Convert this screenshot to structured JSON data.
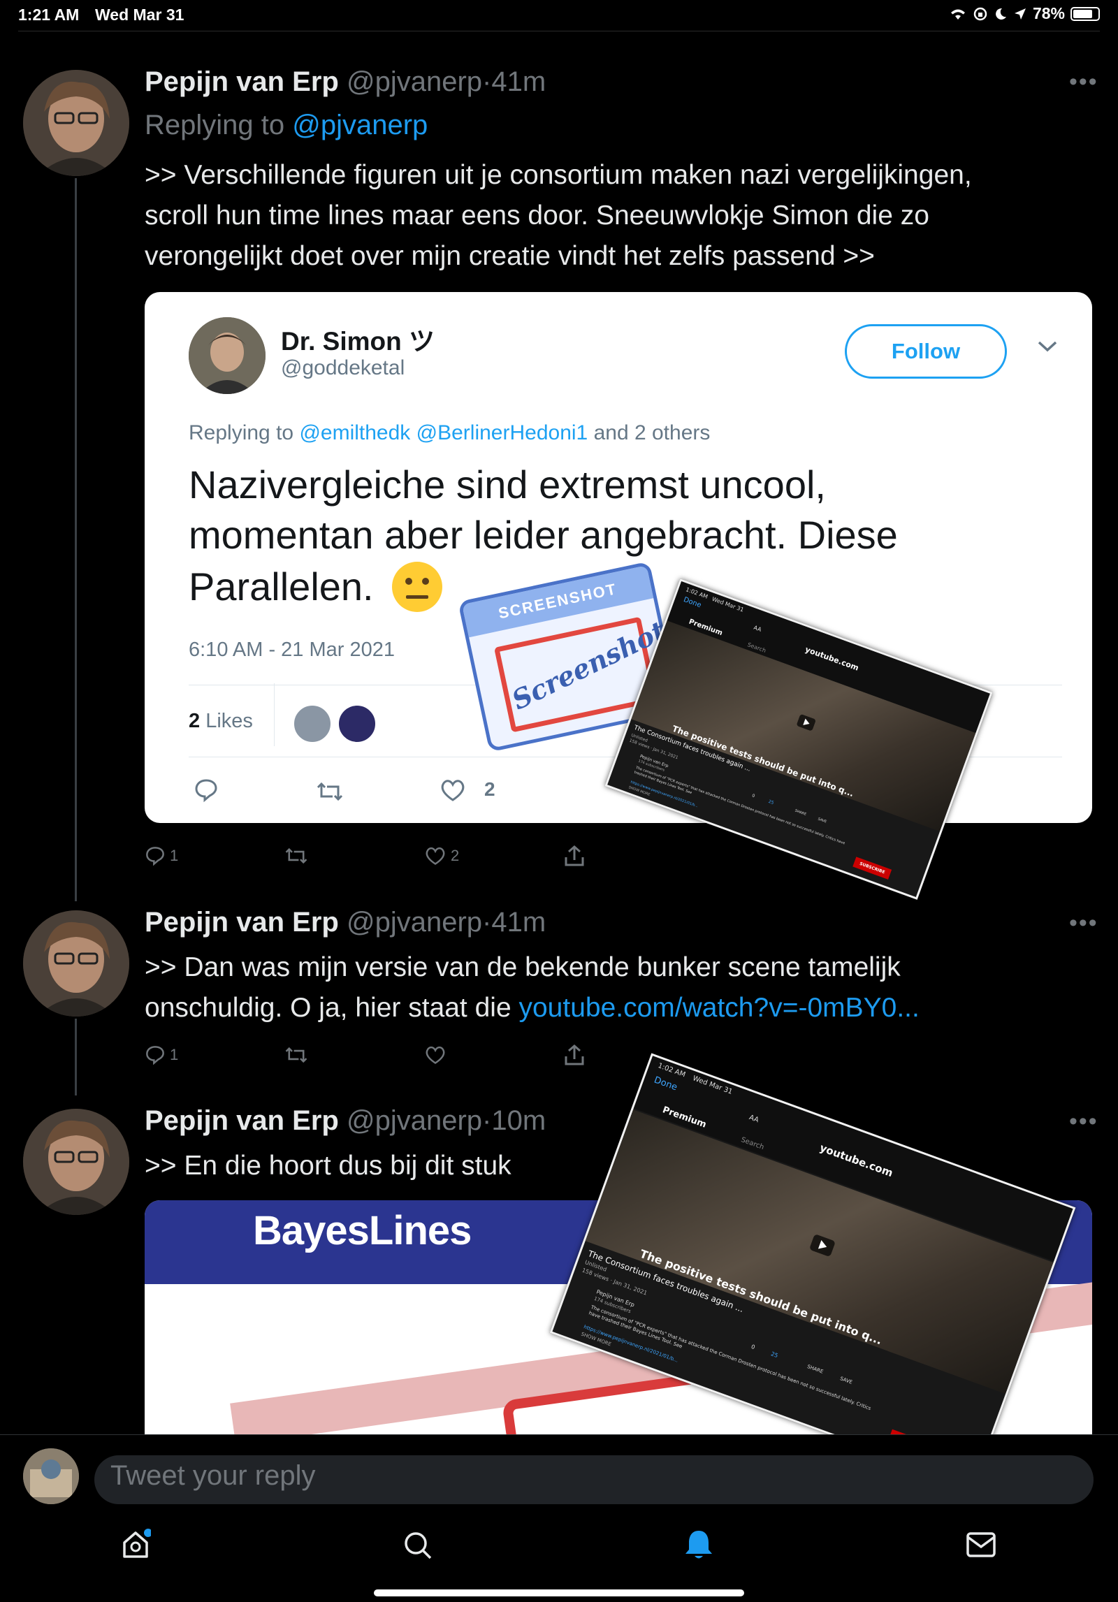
{
  "status_bar": {
    "time": "1:21 AM",
    "date": "Wed Mar 31",
    "battery": "78%"
  },
  "tweets": [
    {
      "name": "Pepijn van Erp",
      "handle": "@pjvanerp",
      "dot": "·",
      "time": "41m",
      "replying_prefix": "Replying to",
      "replying_to": "@pjvanerp",
      "text_lines": [
        ">> Verschillende figuren uit je consortium maken nazi vergelijkingen,",
        "scroll hun time lines maar eens door. Sneeuwvlokje Simon die zo",
        "verongelijkt doet over mijn creatie vindt het zelfs passend >>"
      ],
      "stats": {
        "replies": "1",
        "retweets": "",
        "likes": "2"
      }
    },
    {
      "name": "Pepijn van Erp",
      "handle": "@pjvanerp",
      "dot": "·",
      "time": "41m",
      "text_line1": ">> Dan was mijn versie van de bekende bunker scene tamelijk",
      "text_line2_prefix": "onschuldig. O ja, hier staat die",
      "link": "youtube.com/watch?v=-0mBY0...",
      "stats": {
        "replies": "1",
        "retweets": "",
        "likes": ""
      }
    },
    {
      "name": "Pepijn van Erp",
      "handle": "@pjvanerp",
      "dot": "·",
      "time": "10m",
      "text": ">> En die hoort dus bij dit stuk"
    }
  ],
  "embedded_tweet": {
    "name": "Dr. Simon ツ",
    "handle": "@goddeketal",
    "follow_label": "Follow",
    "replying_prefix": "Replying to",
    "mention1": "@emilthedk",
    "mention2": "@BerlinerHedoni1",
    "replying_suffix": "and 2 others",
    "text_lines": [
      "Nazivergleiche sind extremst uncool,",
      "momentan aber leider angebracht. Diese",
      "Parallelen."
    ],
    "timestamp": "6:10 AM - 21 Mar 2021",
    "likes_count": "2",
    "likes_label": "Likes",
    "like_action_count": "2"
  },
  "screenshot_sticker": {
    "top": "SCREENSHOT",
    "script": "Screenshot"
  },
  "bayes_card": {
    "title": "BayesLines"
  },
  "youtube_overlay": {
    "status_time": "1:02 AM",
    "status_date": "Wed Mar 31",
    "done": "Done",
    "aa": "AA",
    "url": "youtube.com",
    "premium": "Premium",
    "search_placeholder": "Search",
    "subtitle": "The positive tests should be put into q...",
    "video_title": "The Consortium faces troubles again ...",
    "visibility": "Unlisted",
    "views": "158 views · Jan 31, 2021",
    "channel": "Pepijn van Erp",
    "subscribers": "174 subscribers",
    "likes": "0",
    "dislikes": "25",
    "share": "SHARE",
    "save": "SAVE",
    "subscribe": "SUBSCRIBE",
    "description": "The consortium of \"PCR experts\" that has attacked the Corman Drosten protocol has been not so successful lately. Critics have trashed their Bayes Lines Tool. See",
    "desc_link": "https://www.pepijnvanerp.nl/2021/01/b...",
    "show_more": "SHOW MORE"
  },
  "composer": {
    "placeholder": "Tweet your reply"
  },
  "icons": [
    "wifi-icon",
    "orientation-lock-icon",
    "moon-icon",
    "location-arrow-icon",
    "battery-icon",
    "more-icon",
    "reply-icon",
    "retweet-icon",
    "like-icon",
    "share-icon",
    "home-icon",
    "search-icon",
    "notifications-icon",
    "messages-icon",
    "chevron-down-icon",
    "neutral-face-emoji",
    "play-icon"
  ],
  "colors": {
    "background": "#000000",
    "link": "#1d9bf0",
    "muted": "#71767b",
    "follow_blue": "#1da1f2",
    "bayes_blue": "#2b3590",
    "youtube_red": "#cc0000"
  }
}
